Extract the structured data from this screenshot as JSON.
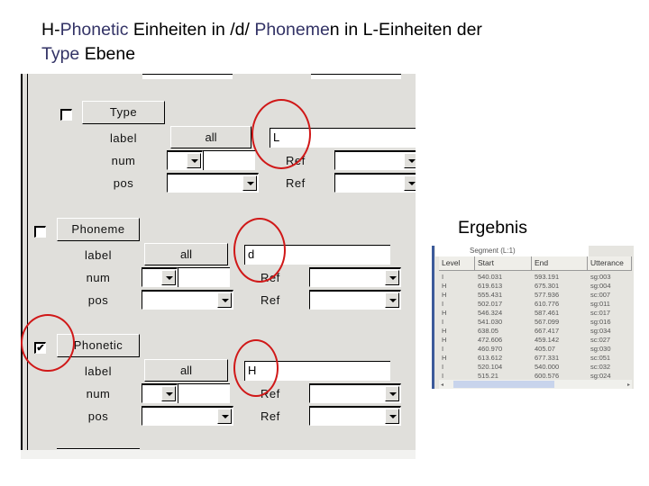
{
  "title": {
    "line1_parts": [
      {
        "text": "H-",
        "highlight": false
      },
      {
        "text": "Phonetic",
        "highlight": true
      },
      {
        "text": " Einheiten in /d/ ",
        "highlight": false
      },
      {
        "text": "Phoneme",
        "highlight": true
      },
      {
        "text": "n in L-Einheiten der",
        "highlight": false
      }
    ],
    "line2_parts": [
      {
        "text": "Type",
        "highlight": true
      },
      {
        "text": " Ebene",
        "highlight": false
      }
    ]
  },
  "colors": {
    "highlight_text": "#333366",
    "annotation_circle": "#d01818",
    "panel_bg": "#e0dfdb"
  },
  "query_panel": {
    "groups": [
      {
        "level": "Type",
        "checked": false,
        "check_glyph": "",
        "label_caption": "label",
        "all_button": "all",
        "label_value": "L",
        "num_caption": "num",
        "pos_caption": "pos",
        "ref1_caption": "Ref",
        "ref2_caption": "Ref"
      },
      {
        "level": "Phoneme",
        "checked": false,
        "check_glyph": "",
        "label_caption": "label",
        "all_button": "all",
        "label_value": "d",
        "num_caption": "num",
        "pos_caption": "pos",
        "ref1_caption": "Ref",
        "ref2_caption": "Ref"
      },
      {
        "level": "Phonetic",
        "checked": true,
        "check_glyph": "✔",
        "label_caption": "label",
        "all_button": "all",
        "label_value": "H",
        "num_caption": "num",
        "pos_caption": "pos",
        "ref1_caption": "Ref",
        "ref2_caption": "Ref"
      }
    ]
  },
  "result": {
    "heading": "Ergebnis",
    "tab_label": "Segment (L:1)",
    "columns": [
      "Level",
      "Start",
      "End",
      "Utterance"
    ],
    "rows": [
      [
        "I",
        "540.031",
        "593.191",
        "sg:003"
      ],
      [
        "H",
        "619.613",
        "675.301",
        "sg:004"
      ],
      [
        "H",
        "555.431",
        "577.936",
        "sc:007"
      ],
      [
        "I",
        "502.017",
        "610.776",
        "sg:011"
      ],
      [
        "H",
        "546.324",
        "587.461",
        "sc:017"
      ],
      [
        "I",
        "541.030",
        "567.099",
        "sg:016"
      ],
      [
        "H",
        "638.05",
        "667.417",
        "sg:034"
      ],
      [
        "H",
        "472.606",
        "459.142",
        "sc:027"
      ],
      [
        "I",
        "460.970",
        "405.07",
        "sg:030"
      ],
      [
        "H",
        "613.612",
        "677.331",
        "sc:051"
      ],
      [
        "I",
        "520.104",
        "540.000",
        "sc:032"
      ],
      [
        "I",
        "515.21",
        "600.576",
        "sg:024"
      ],
      [
        "I",
        "",
        "",
        ""
      ]
    ],
    "scroll_left": "◂",
    "scroll_right": "▸"
  }
}
